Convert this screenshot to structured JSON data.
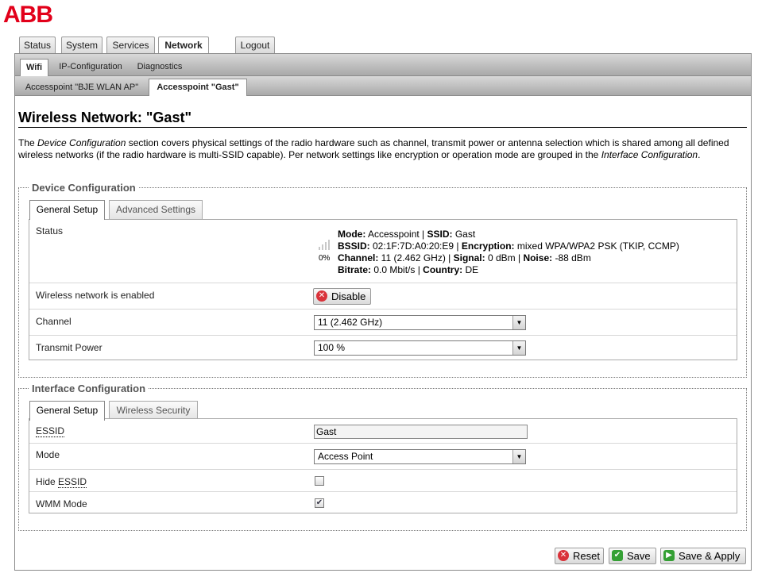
{
  "brand": {
    "logo_text": "ABB",
    "color": "#e2001a"
  },
  "main_tabs": [
    {
      "label": "Status",
      "active": false
    },
    {
      "label": "System",
      "active": false
    },
    {
      "label": "Services",
      "active": false
    },
    {
      "label": "Network",
      "active": true
    },
    {
      "label": "Logout",
      "active": false
    }
  ],
  "sub_tabs": [
    {
      "label": "Wifi",
      "active": true
    },
    {
      "label": "IP-Configuration",
      "active": false
    },
    {
      "label": "Diagnostics",
      "active": false
    }
  ],
  "ap_tabs": [
    {
      "label": "Accesspoint \"BJE WLAN AP\"",
      "active": false
    },
    {
      "label": "Accesspoint \"Gast\"",
      "active": true
    }
  ],
  "page": {
    "title": "Wireless Network: \"Gast\"",
    "desc_p1": "The ",
    "desc_em1": "Device Configuration",
    "desc_p2": " section covers physical settings of the radio hardware such as channel, transmit power or antenna selection which is shared among all defined wireless networks (if the radio hardware is multi-SSID capable). Per network settings like encryption or operation mode are grouped in the ",
    "desc_em2": "Interface Configuration",
    "desc_p3": "."
  },
  "device_config": {
    "legend": "Device Configuration",
    "tabs": [
      {
        "label": "General Setup",
        "active": true
      },
      {
        "label": "Advanced Settings",
        "active": false
      }
    ],
    "status": {
      "label": "Status",
      "signal_percent": "0%",
      "mode_key": "Mode:",
      "mode_val": " Accesspoint | ",
      "ssid_key": "SSID:",
      "ssid_val": " Gast",
      "bssid_key": "BSSID:",
      "bssid_val": " 02:1F:7D:A0:20:E9 | ",
      "enc_key": "Encryption:",
      "enc_val": " mixed WPA/WPA2 PSK (TKIP, CCMP)",
      "channel_key": "Channel:",
      "channel_val": " 11 (2.462 GHz) | ",
      "signal_key": "Signal:",
      "signal_val": " 0 dBm | ",
      "noise_key": "Noise:",
      "noise_val": " -88 dBm",
      "bitrate_key": "Bitrate:",
      "bitrate_val": " 0.0 Mbit/s | ",
      "country_key": "Country:",
      "country_val": " DE"
    },
    "enabled_label": "Wireless network is enabled",
    "disable_button": "Disable",
    "channel_label": "Channel",
    "channel_value": "11 (2.462 GHz)",
    "txpower_label": "Transmit Power",
    "txpower_value": "100 %"
  },
  "interface_config": {
    "legend": "Interface Configuration",
    "tabs": [
      {
        "label": "General Setup",
        "active": true
      },
      {
        "label": "Wireless Security",
        "active": false
      }
    ],
    "essid_label": "ESSID",
    "essid_value": "Gast",
    "mode_label": "Mode",
    "mode_value": "Access Point",
    "hide_label_prefix": "Hide ",
    "hide_label_abbr": "ESSID",
    "hide_checked": false,
    "wmm_label": "WMM Mode",
    "wmm_checked": true
  },
  "footer": {
    "reset": "Reset",
    "save": "Save",
    "save_apply": "Save & Apply"
  }
}
